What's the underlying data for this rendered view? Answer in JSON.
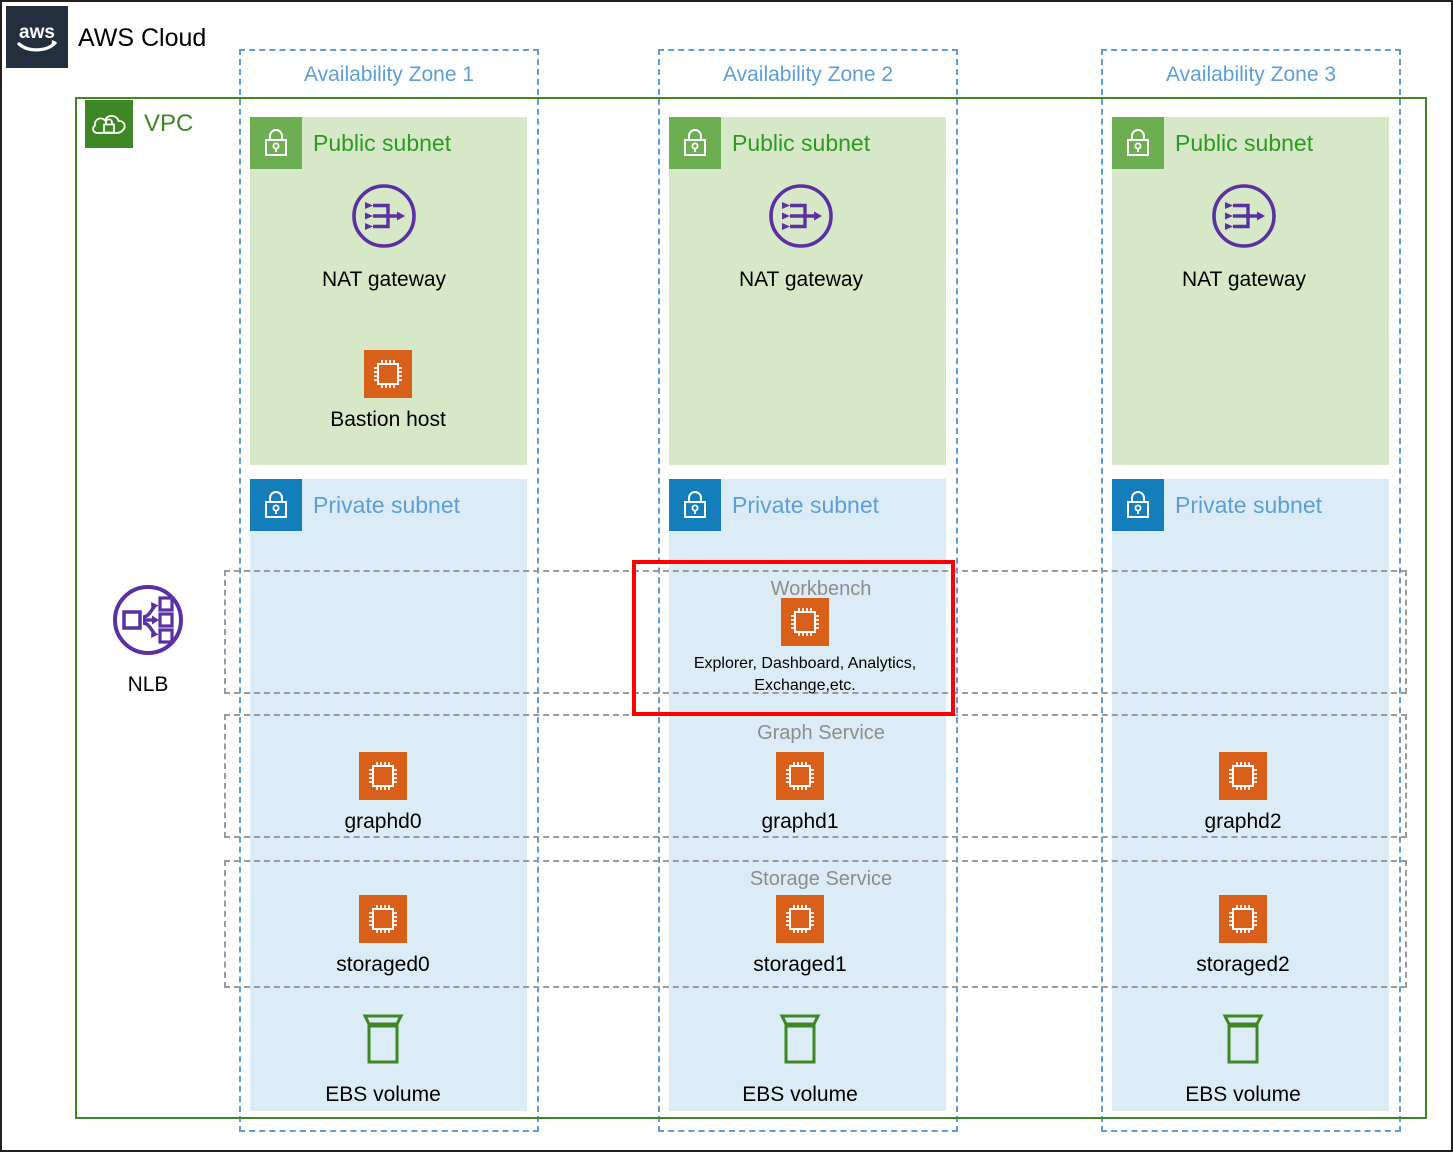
{
  "cloud": {
    "title": "AWS Cloud",
    "logo_icon": "aws-logo-icon"
  },
  "vpc": {
    "label": "VPC",
    "icon": "vpc-cloud-lock-icon",
    "border_color": "#3f8624"
  },
  "nlb": {
    "label": "NLB",
    "icon": "network-load-balancer-icon",
    "color": "#5a31a3"
  },
  "availability_zones": [
    {
      "label": "Availability Zone 1"
    },
    {
      "label": "Availability Zone 2"
    },
    {
      "label": "Availability Zone 3"
    }
  ],
  "subnets": {
    "public_label": "Public subnet",
    "private_label": "Private subnet",
    "public_icon": "padlock-icon",
    "private_icon": "padlock-icon",
    "public_bg": "#d6e8c8",
    "private_bg": "#dcecf7",
    "public_accent": "#6cae51",
    "private_accent": "#147eba"
  },
  "service_groups": [
    {
      "title": "Workbench"
    },
    {
      "title": "Graph Service"
    },
    {
      "title": "Storage Service"
    }
  ],
  "highlight": {
    "color": "#ff0000"
  },
  "nodes": {
    "nat_gateways": [
      {
        "label": "NAT gateway",
        "icon": "nat-gateway-icon"
      },
      {
        "label": "NAT gateway",
        "icon": "nat-gateway-icon"
      },
      {
        "label": "NAT gateway",
        "icon": "nat-gateway-icon"
      }
    ],
    "bastion": {
      "label": "Bastion host",
      "icon": "ec2-instance-icon"
    },
    "workbench": {
      "label": "Explorer, Dashboard, Analytics, Exchange,etc.",
      "icon": "ec2-instance-icon"
    },
    "graphd": [
      {
        "label": "graphd0",
        "icon": "ec2-instance-icon"
      },
      {
        "label": "graphd1",
        "icon": "ec2-instance-icon"
      },
      {
        "label": "graphd2",
        "icon": "ec2-instance-icon"
      }
    ],
    "storaged": [
      {
        "label": "storaged0",
        "icon": "ec2-instance-icon"
      },
      {
        "label": "storaged1",
        "icon": "ec2-instance-icon"
      },
      {
        "label": "storaged2",
        "icon": "ec2-instance-icon"
      }
    ],
    "ebs": [
      {
        "label": "EBS volume",
        "icon": "ebs-volume-icon"
      },
      {
        "label": "EBS volume",
        "icon": "ebs-volume-icon"
      },
      {
        "label": "EBS volume",
        "icon": "ebs-volume-icon"
      }
    ]
  }
}
